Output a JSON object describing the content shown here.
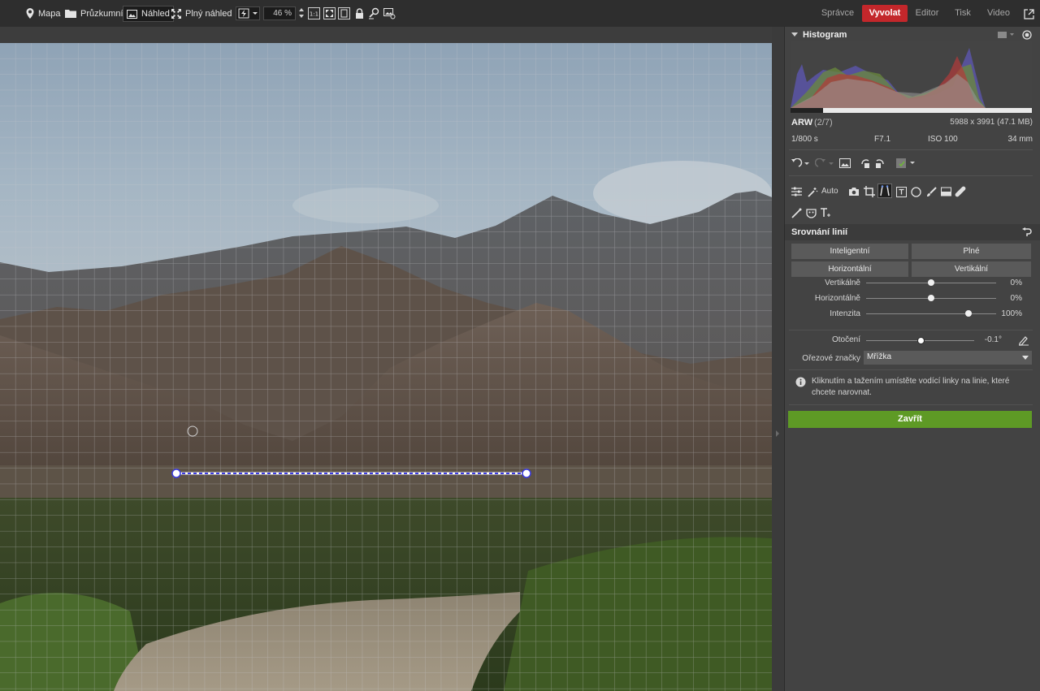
{
  "toolbar": {
    "map": "Mapa",
    "explorer": "Průzkumník",
    "preview": "Náhled",
    "fullscreen": "Plný náhled",
    "zoom": "46 %",
    "one_to_one": "1:1"
  },
  "modules": [
    {
      "label": "Správce",
      "active": false
    },
    {
      "label": "Vyvolat",
      "active": true
    },
    {
      "label": "Editor",
      "active": false
    },
    {
      "label": "Tisk",
      "active": false
    },
    {
      "label": "Video",
      "active": false
    }
  ],
  "histogram": {
    "title": "Histogram"
  },
  "file_info": {
    "format": "ARW",
    "index": "(2/7)",
    "dimensions": "5988 x 3991 (47.1 MB)",
    "shutter": "1/800 s",
    "aperture": "F7.1",
    "iso": "ISO 100",
    "focal": "34 mm"
  },
  "tools": {
    "auto_label": "Auto"
  },
  "straighten": {
    "title": "Srovnání linií",
    "buttons": [
      "Inteligentní",
      "Plné",
      "Horizontální",
      "Vertikální"
    ],
    "sliders": [
      {
        "label": "Vertikálně",
        "value": "0%",
        "level": 0.5
      },
      {
        "label": "Horizontálně",
        "value": "0%",
        "level": 0.5
      },
      {
        "label": "Intenzita",
        "value": "100%",
        "level": 0.79
      }
    ],
    "rotation": {
      "label": "Otočení",
      "value": "-0.1°",
      "level": 0.5
    },
    "crop_marks": {
      "label": "Ořezové značky",
      "value": "Mřížka"
    },
    "info": "Kliknutím a tažením umístěte vodící linky na linie, které chcete narovnat.",
    "close": "Zavřít"
  },
  "colors": {
    "accent_red": "#c3272b",
    "close_green": "#5e9a25",
    "guide_line": "#3b3be0"
  }
}
